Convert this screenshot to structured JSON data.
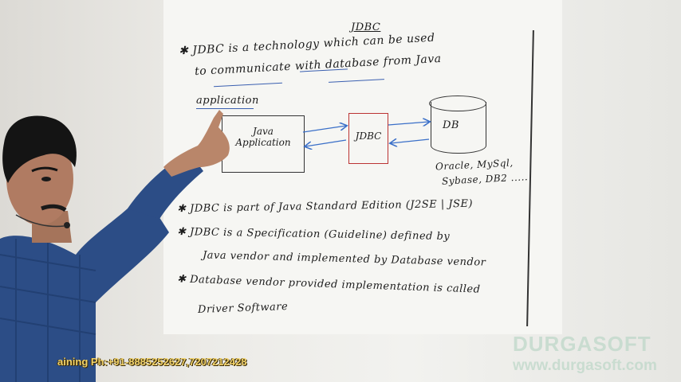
{
  "board": {
    "title": "JDBC",
    "bullet1_line1": "✱ JDBC is a technology which can be used",
    "bullet1_line2": "to communicate with database from Java",
    "bullet1_line3": "application",
    "diagram": {
      "java_box": "Java Application",
      "jdbc_box": "JDBC",
      "db_label": "DB",
      "db_vendors_line1": "Oracle, MySql,",
      "db_vendors_line2": "Sybase, DB2 ....."
    },
    "bullet2": "✱ JDBC is part of Java Standard Edition (J2SE | JSE)",
    "bullet3_line1": "✱ JDBC is a Specification (Guideline) defined by",
    "bullet3_line2": "Java vendor and implemented by Database vendor",
    "bullet4_line1": "✱ Database vendor provided implementation is called",
    "bullet4_line2": "Driver Software"
  },
  "overlay": {
    "ticker": "aining Ph:+91-8885252627,7207212428",
    "brand": "DURGASOFT",
    "brand_url": "www.durgasoft.com"
  },
  "colors": {
    "ticker": "#f2d36b",
    "brand_watermark": "#bed7c8",
    "shirt": "#2c4d86",
    "arrow": "#3a6fc8"
  }
}
